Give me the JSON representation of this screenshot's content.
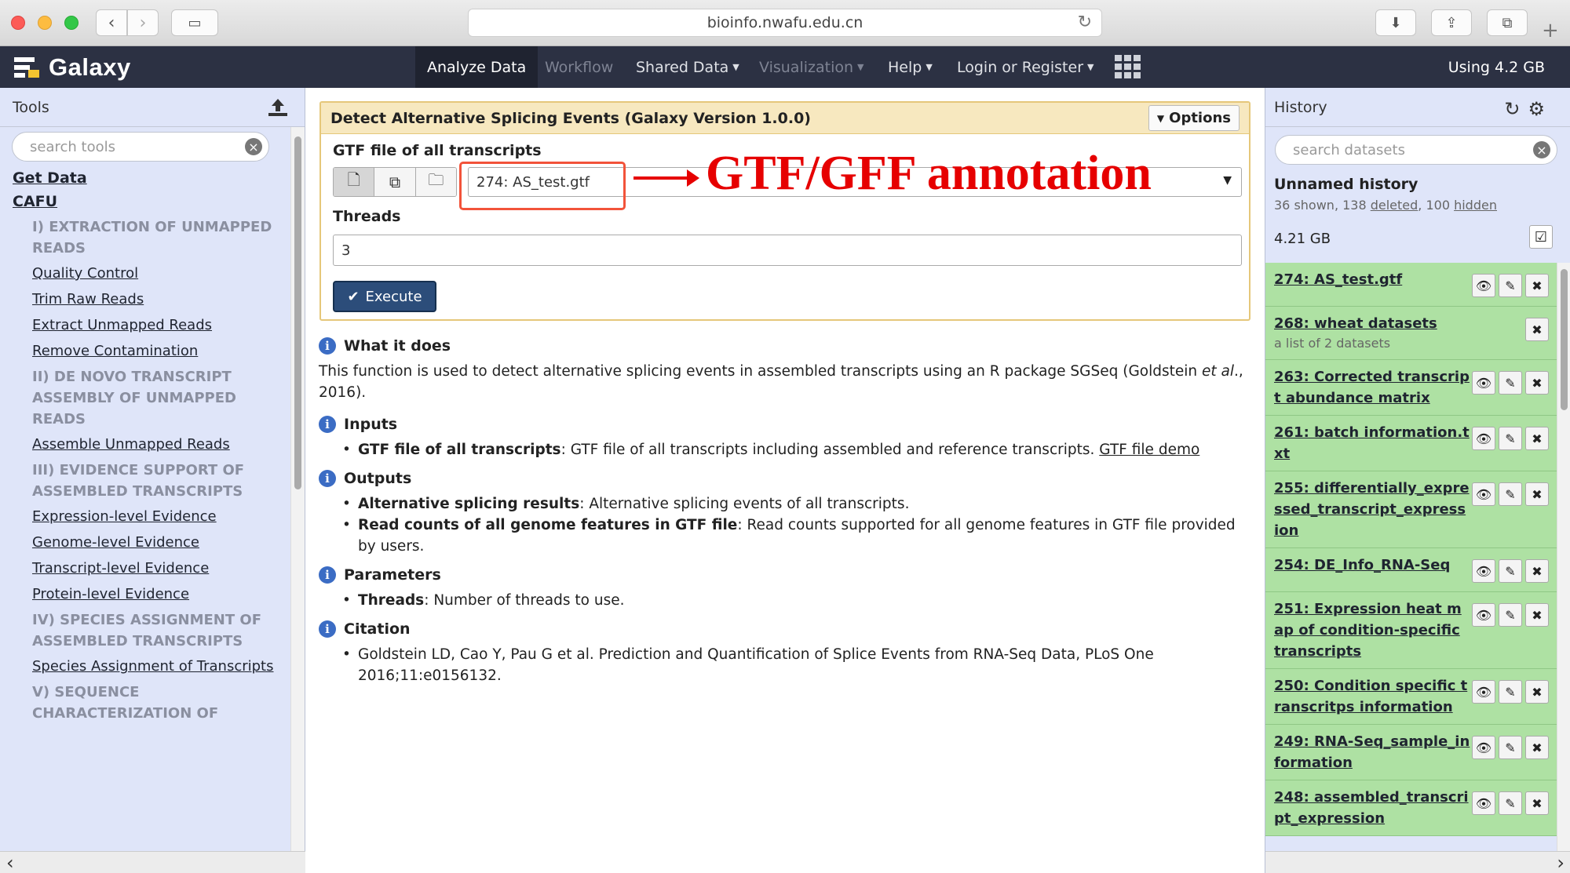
{
  "browser": {
    "url": "bioinfo.nwafu.edu.cn"
  },
  "masthead": {
    "brand": "Galaxy",
    "nav": [
      {
        "label": "Analyze Data"
      },
      {
        "label": "Workflow"
      },
      {
        "label": "Shared Data"
      },
      {
        "label": "Visualization"
      },
      {
        "label": "Help"
      },
      {
        "label": "Login or Register"
      }
    ],
    "usage": "Using 4.2 GB"
  },
  "tools": {
    "title": "Tools",
    "search_placeholder": "search tools",
    "items": [
      {
        "kind": "top",
        "text": "Get Data"
      },
      {
        "kind": "top",
        "text": "CAFU"
      },
      {
        "kind": "label",
        "text": "I) EXTRACTION OF UNMAPPED READS"
      },
      {
        "kind": "link",
        "text": "Quality Control"
      },
      {
        "kind": "link",
        "text": "Trim Raw Reads"
      },
      {
        "kind": "link",
        "text": "Extract Unmapped Reads"
      },
      {
        "kind": "link",
        "text": "Remove Contamination"
      },
      {
        "kind": "label",
        "text": "II) DE NOVO TRANSCRIPT ASSEMBLY OF UNMAPPED READS"
      },
      {
        "kind": "link",
        "text": "Assemble Unmapped Reads"
      },
      {
        "kind": "label",
        "text": "III) EVIDENCE SUPPORT OF ASSEMBLED TRANSCRIPTS"
      },
      {
        "kind": "link",
        "text": "Expression-level Evidence"
      },
      {
        "kind": "link",
        "text": "Genome-level Evidence"
      },
      {
        "kind": "link",
        "text": "Transcript-level Evidence"
      },
      {
        "kind": "link",
        "text": "Protein-level Evidence"
      },
      {
        "kind": "label",
        "text": "IV) SPECIES ASSIGNMENT OF ASSEMBLED TRANSCRIPTS"
      },
      {
        "kind": "link",
        "text": "Species Assignment of Transcripts"
      },
      {
        "kind": "label",
        "text": "V) SEQUENCE CHARACTERIZATION OF"
      }
    ]
  },
  "form": {
    "title": "Detect Alternative Splicing Events (Galaxy Version 1.0.0)",
    "options_label": "Options",
    "gtf_label": "GTF file of all transcripts",
    "gtf_value": "274: AS_test.gtf",
    "annotation": "GTF/GFF annotation",
    "threads_label": "Threads",
    "threads_value": "3",
    "execute_label": "Execute"
  },
  "help": {
    "what_title": "What it does",
    "what_text_1": "This function is used to detect alternative splicing events in assembled transcripts using an R package SGSeq (Goldstein ",
    "what_text_em": "et al",
    "what_text_2": "., 2016).",
    "inputs_title": "Inputs",
    "input_1_term": "GTF file of all transcripts",
    "input_1_text": ": GTF file of all transcripts including assembled and reference transcripts. ",
    "input_1_link": "GTF file demo",
    "outputs_title": "Outputs",
    "output_1_term": "Alternative splicing results",
    "output_1_text": ": Alternative splicing events of all transcripts.",
    "output_2_term": "Read counts of all genome features in GTF file",
    "output_2_text": ": Read counts supported for all genome features in GTF file provided by users.",
    "params_title": "Parameters",
    "param_1_term": "Threads",
    "param_1_text": ": Number of threads to use.",
    "citation_title": "Citation",
    "citation_text": "Goldstein LD, Cao Y, Pau G et al. Prediction and Quantification of Splice Events from RNA-Seq Data, PLoS One 2016;11:e0156132."
  },
  "history": {
    "title": "History",
    "search_placeholder": "search datasets",
    "name": "Unnamed history",
    "counts_prefix": "36 shown, 138 ",
    "deleted": "deleted",
    "counts_sep": ", 100 ",
    "hidden": "hidden",
    "size": "4.21 GB",
    "datasets": [
      {
        "title": "274: AS_test.gtf",
        "sub": "",
        "full": true
      },
      {
        "title": "268: wheat datasets",
        "sub": "a list of 2 datasets",
        "full": false
      },
      {
        "title": "263: Corrected transcript abundance matrix",
        "sub": "",
        "full": true
      },
      {
        "title": "261: batch information.txt",
        "sub": "",
        "full": true
      },
      {
        "title": "255: differentially_expressed_transcript_expression",
        "sub": "",
        "full": true
      },
      {
        "title": "254: DE_Info_RNA-Seq",
        "sub": "",
        "full": true
      },
      {
        "title": "251: Expression heat map of condition-specific transcripts",
        "sub": "",
        "full": true
      },
      {
        "title": "250: Condition specific transcritps information",
        "sub": "",
        "full": true
      },
      {
        "title": "249: RNA-Seq_sample_information",
        "sub": "",
        "full": true
      },
      {
        "title": "248: assembled_transcript_expression",
        "sub": "",
        "full": true
      }
    ]
  }
}
